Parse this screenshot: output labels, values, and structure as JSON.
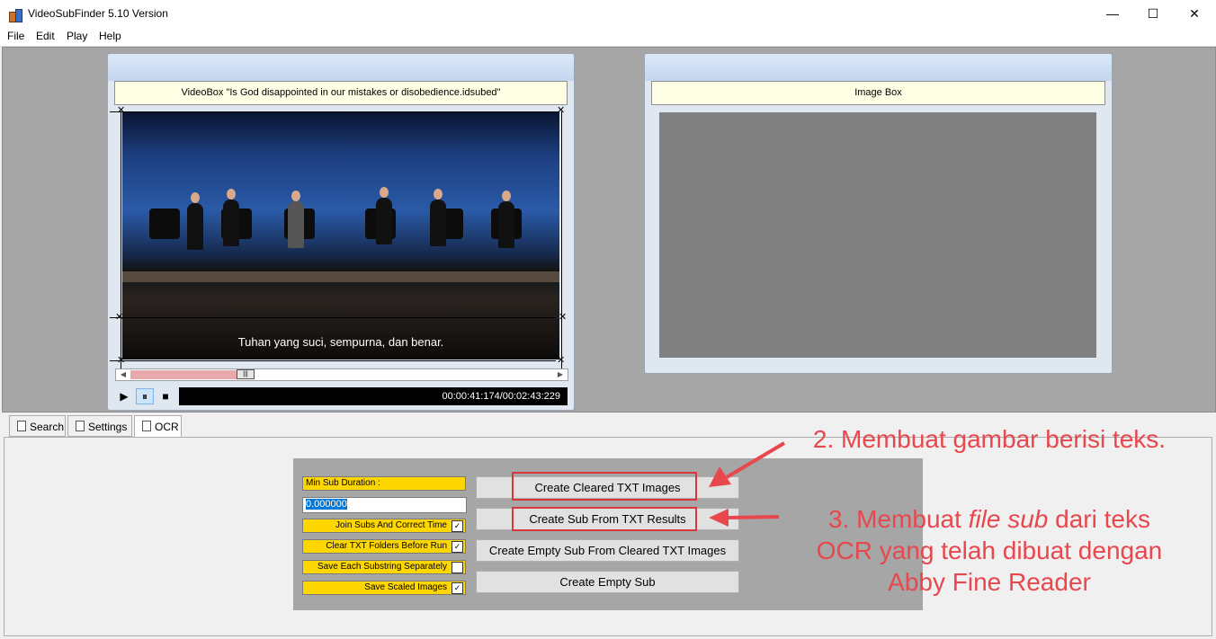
{
  "window": {
    "title": "VideoSubFinder 5.10 Version",
    "minimize": "—",
    "maximize": "☐",
    "close": "✕"
  },
  "menu": [
    "File",
    "Edit",
    "Play",
    "Help"
  ],
  "video_panel": {
    "title": "VideoBox \"Is God disappointed in our mistakes or disobedience.idsubed\"",
    "subtitle": "Tuhan yang suci, sempurna, dan benar.",
    "time": "00:00:41:174/00:02:43:229",
    "playback_progress": 0.25
  },
  "image_panel": {
    "title": "Image Box"
  },
  "controls": {
    "play": "▶",
    "pause": "⏸",
    "stop": "■"
  },
  "tabs": [
    "Search",
    "Settings",
    "OCR"
  ],
  "ocr": {
    "min_sub_duration_label": "Min Sub Duration :",
    "min_sub_duration_value": "0.000000",
    "options": [
      {
        "label": "Join Subs And Correct Time",
        "checked": true,
        "check": "✓"
      },
      {
        "label": "Clear TXT Folders Before Run",
        "checked": true,
        "check": "✓"
      },
      {
        "label": "Save Each Substring Separately",
        "checked": false,
        "check": ""
      },
      {
        "label": "Save Scaled Images",
        "checked": true,
        "check": "✓"
      }
    ],
    "buttons": [
      "Create Cleared TXT Images",
      "Create Sub From TXT Results",
      "Create Empty Sub From Cleared TXT Images",
      "Create Empty Sub"
    ]
  },
  "annotations": {
    "note2": "2. Membuat gambar berisi teks.",
    "note3_a": "3. Membuat ",
    "note3_italic": "file sub",
    "note3_b": " dari teks",
    "note3_line2": "OCR yang telah dibuat dengan",
    "note3_line3": "Abby Fine Reader",
    "accent_color": "#e8474d"
  }
}
